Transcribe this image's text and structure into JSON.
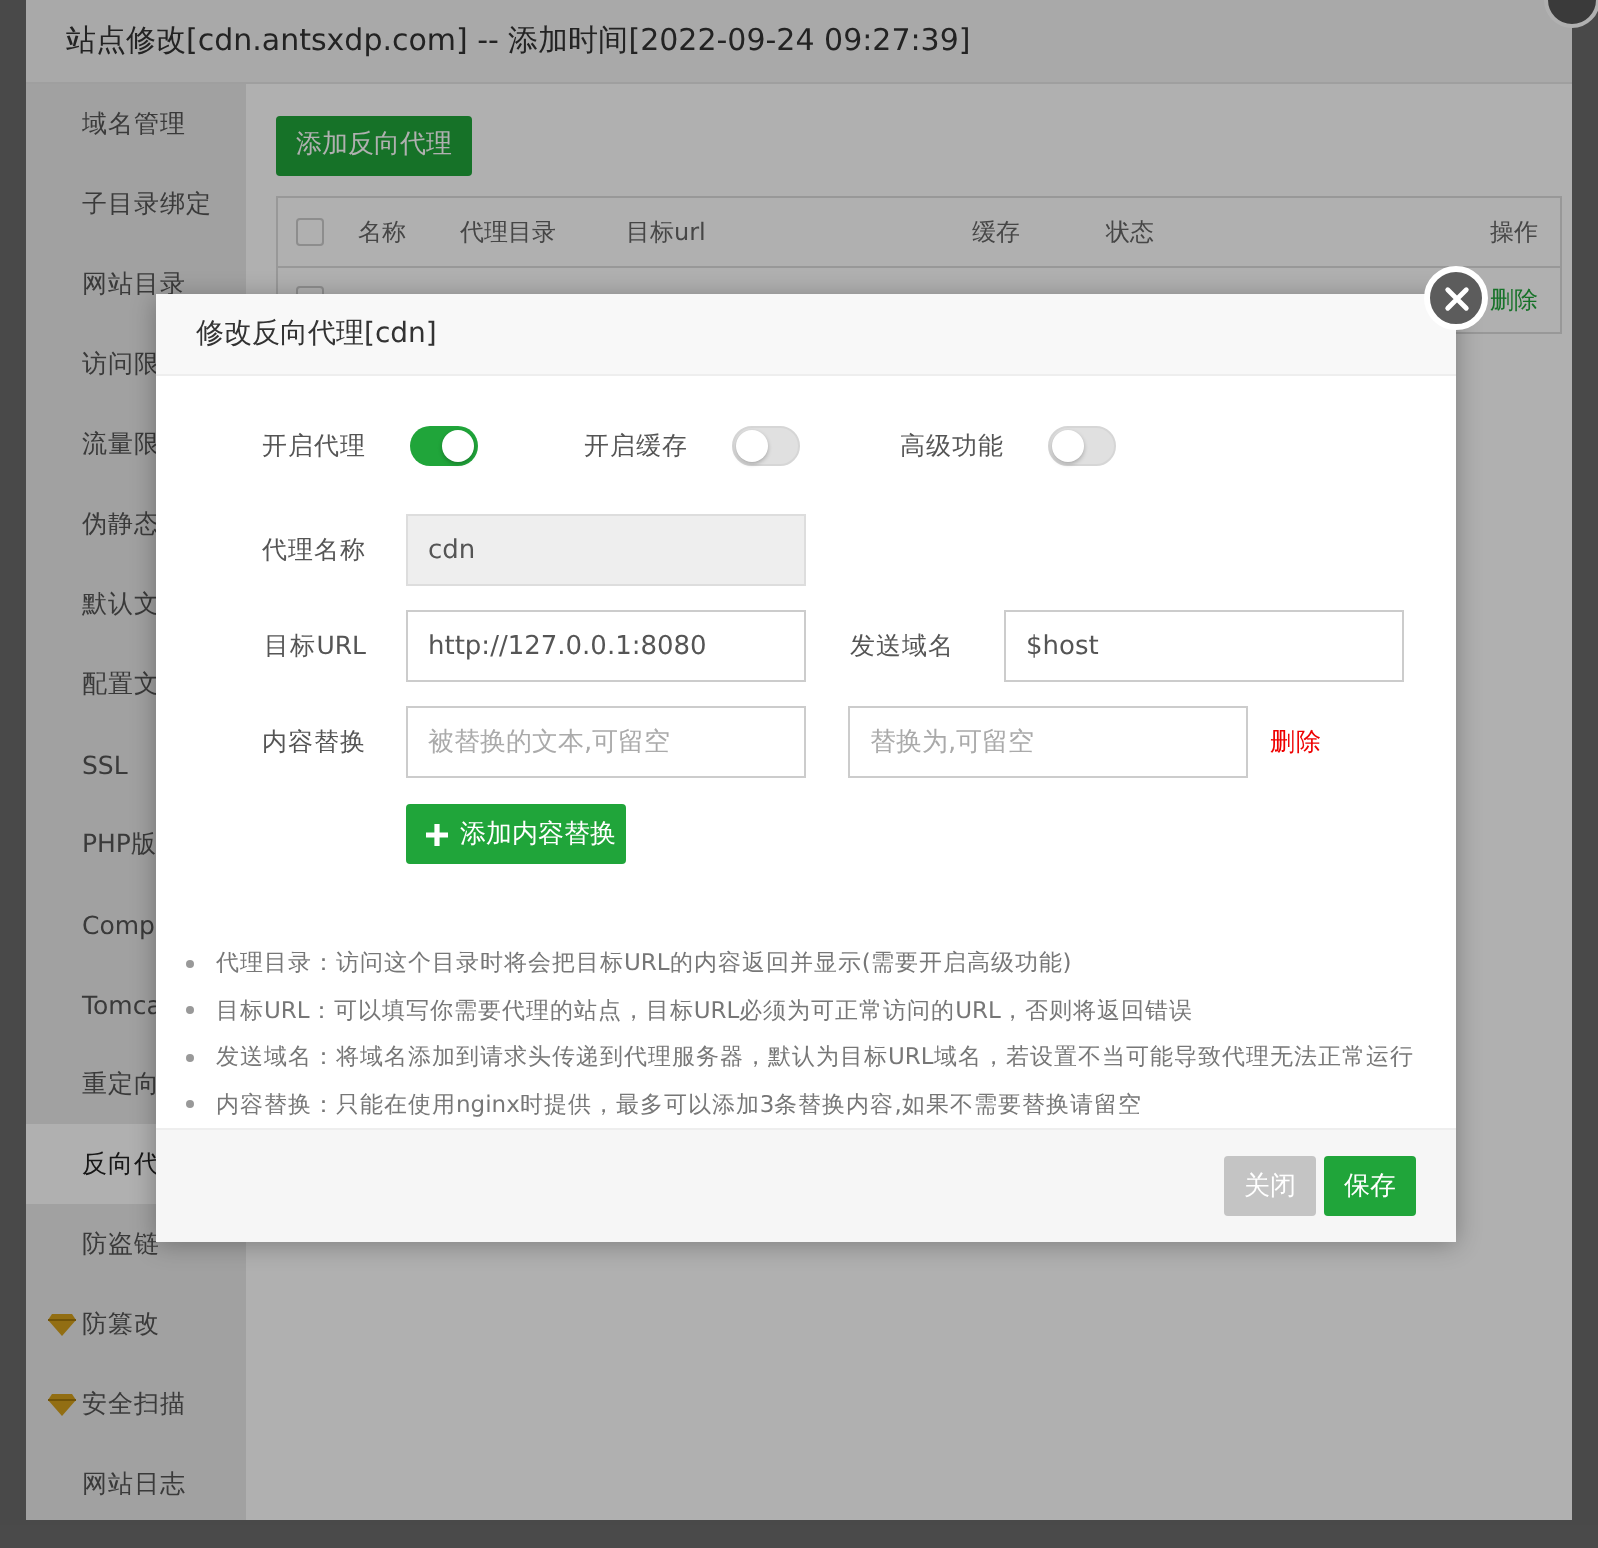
{
  "window": {
    "title": "站点修改[cdn.antsxdp.com] -- 添加时间[2022-09-24 09:27:39]"
  },
  "sidebar": {
    "items": [
      {
        "label": "域名管理",
        "selected": false,
        "premium": false
      },
      {
        "label": "子目录绑定",
        "selected": false,
        "premium": false
      },
      {
        "label": "网站目录",
        "selected": false,
        "premium": false
      },
      {
        "label": "访问限",
        "selected": false,
        "premium": false
      },
      {
        "label": "流量限",
        "selected": false,
        "premium": false
      },
      {
        "label": "伪静态",
        "selected": false,
        "premium": false
      },
      {
        "label": "默认文",
        "selected": false,
        "premium": false
      },
      {
        "label": "配置文",
        "selected": false,
        "premium": false
      },
      {
        "label": "SSL",
        "selected": false,
        "premium": false
      },
      {
        "label": "PHP版",
        "selected": false,
        "premium": false
      },
      {
        "label": "Comp",
        "selected": false,
        "premium": false
      },
      {
        "label": "Tomca",
        "selected": false,
        "premium": false
      },
      {
        "label": "重定向",
        "selected": false,
        "premium": false
      },
      {
        "label": "反向代",
        "selected": true,
        "premium": false
      },
      {
        "label": "防盗链",
        "selected": false,
        "premium": false
      },
      {
        "label": "防篡改",
        "selected": false,
        "premium": true
      },
      {
        "label": "安全扫描",
        "selected": false,
        "premium": true
      },
      {
        "label": "网站日志",
        "selected": false,
        "premium": false
      }
    ]
  },
  "content": {
    "add_button": "添加反向代理",
    "table": {
      "select_all_checked": false,
      "columns": [
        "名称",
        "代理目录",
        "目标url",
        "缓存",
        "状态",
        "操作"
      ],
      "rows": [
        {
          "checked": false,
          "action": "删除"
        }
      ]
    }
  },
  "dialog": {
    "title": "修改反向代理[cdn]",
    "switches": [
      {
        "label": "开启代理",
        "on": true
      },
      {
        "label": "开启缓存",
        "on": false
      },
      {
        "label": "高级功能",
        "on": false
      }
    ],
    "proxy_name": {
      "label": "代理名称",
      "value": "cdn",
      "disabled": true
    },
    "target_url": {
      "label": "目标URL",
      "value": "http://127.0.0.1:8080"
    },
    "send_domain": {
      "label": "发送域名",
      "value": "$host"
    },
    "replace": {
      "label": "内容替换",
      "from_placeholder": "被替换的文本,可留空",
      "to_placeholder": "替换为,可留空",
      "delete": "删除"
    },
    "add_replace_button": "添加内容替换",
    "notes": [
      "代理目录：访问这个目录时将会把目标URL的内容返回并显示(需要开启高级功能)",
      "目标URL：可以填写你需要代理的站点，目标URL必须为可正常访问的URL，否则将返回错误",
      "发送域名：将域名添加到请求头传递到代理服务器，默认为目标URL域名，若设置不当可能导致代理无法正常运行",
      "内容替换：只能在使用nginx时提供，最多可以添加3条替换内容,如果不需要替换请留空"
    ],
    "buttons": [
      {
        "label": "关闭",
        "kind": "secondary"
      },
      {
        "label": "保存",
        "kind": "primary"
      }
    ]
  }
}
